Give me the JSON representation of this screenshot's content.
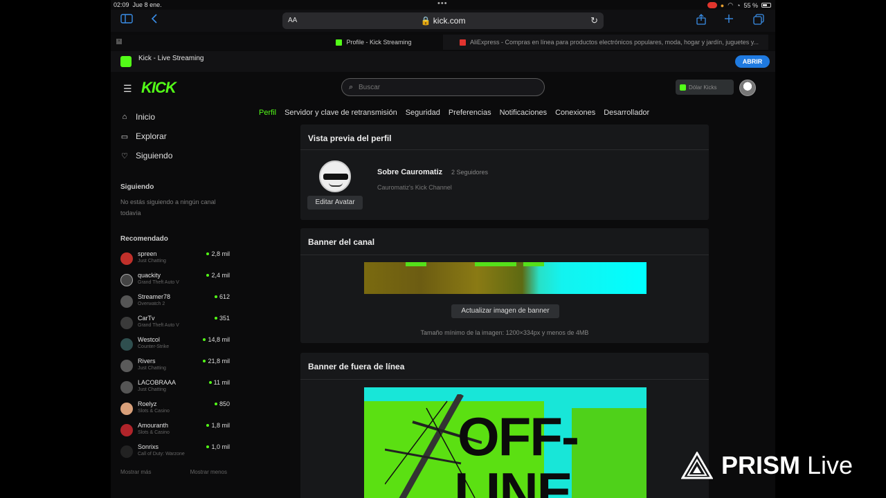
{
  "status_bar": {
    "time": "02:09",
    "date": "Jue 8 ene.",
    "battery": "55 %"
  },
  "browser": {
    "aa_label": "AA",
    "url": "kick.com",
    "tabs": [
      {
        "title": "Profile - Kick Streaming",
        "active": true
      },
      {
        "title": "AliExpress - Compras en línea para productos electrónicos populares, moda, hogar y jardín, juguetes y...",
        "active": false
      }
    ]
  },
  "app_banner": {
    "title": "Kick - Live Streaming",
    "subtitle": "",
    "open_label": "ABRIR"
  },
  "header": {
    "logo": "KICK",
    "search_placeholder": "Buscar",
    "user_chip": "Dólar Kicks"
  },
  "sidebar": {
    "nav": [
      {
        "label": "Inicio",
        "icon": "home-icon"
      },
      {
        "label": "Explorar",
        "icon": "explore-icon"
      },
      {
        "label": "Siguiendo",
        "icon": "heart-icon"
      }
    ],
    "following_heading": "Siguiendo",
    "following_note": "No estás siguiendo a ningún canal todavía",
    "recommended_heading": "Recomendado",
    "recommended": [
      {
        "name": "spreen",
        "game": "Just Chatting",
        "viewers": "2,8 mil",
        "color": "#c0302a"
      },
      {
        "name": "quackity",
        "game": "Grand Theft Auto V",
        "viewers": "2,4 mil",
        "color": "#444"
      },
      {
        "name": "Streamer78",
        "game": "Overwatch 2",
        "viewers": "612",
        "color": "#555"
      },
      {
        "name": "CarTv",
        "game": "Grand Theft Auto V",
        "viewers": "351",
        "color": "#3a3a3a"
      },
      {
        "name": "Westcol",
        "game": "Counter-Strike",
        "viewers": "14,8 mil",
        "color": "#2f4f4f"
      },
      {
        "name": "Rivers",
        "game": "Just Chatting",
        "viewers": "21,8 mil",
        "color": "#5a5a5a"
      },
      {
        "name": "LACOBRAAA",
        "game": "Just Chatting",
        "viewers": "11 mil",
        "color": "#555"
      },
      {
        "name": "Roelyz",
        "game": "Slots & Casino",
        "viewers": "850",
        "color": "#d9a07a"
      },
      {
        "name": "Amouranth",
        "game": "Slots & Casino",
        "viewers": "1,8 mil",
        "color": "#b0242a"
      },
      {
        "name": "Sonrixs",
        "game": "Call of Duty: Warzone",
        "viewers": "1,0 mil",
        "color": "#222"
      }
    ],
    "footer_left": "Mostrar más",
    "footer_right": "Mostrar menos"
  },
  "settings_tabs": [
    {
      "label": "Perfil",
      "active": true
    },
    {
      "label": "Servidor y clave de retransmisión",
      "active": false
    },
    {
      "label": "Seguridad",
      "active": false
    },
    {
      "label": "Preferencias",
      "active": false
    },
    {
      "label": "Notificaciones",
      "active": false
    },
    {
      "label": "Conexiones",
      "active": false
    },
    {
      "label": "Desarrollador",
      "active": false
    }
  ],
  "profile_preview": {
    "heading": "Vista previa del perfil",
    "edit_avatar": "Editar Avatar",
    "about": "Sobre Cauromatiz",
    "followers": "2 Seguidores",
    "description": "Cauromatiz's Kick Channel"
  },
  "channel_banner": {
    "heading": "Banner del canal",
    "update_button": "Actualizar imagen de banner",
    "size_note": "Tamaño mínimo de la imagen: 1200×334px y menos de 4MB"
  },
  "offline_banner": {
    "heading": "Banner de fuera de línea",
    "image_text_line1": "OFF-",
    "image_text_line2": "LINE"
  },
  "watermark": {
    "brand": "PRISM",
    "suffix": "Live"
  },
  "colors": {
    "kick_green": "#53fc18",
    "open_button": "#1f7ae0",
    "background": "#0b0b0c",
    "card": "#17181a"
  }
}
